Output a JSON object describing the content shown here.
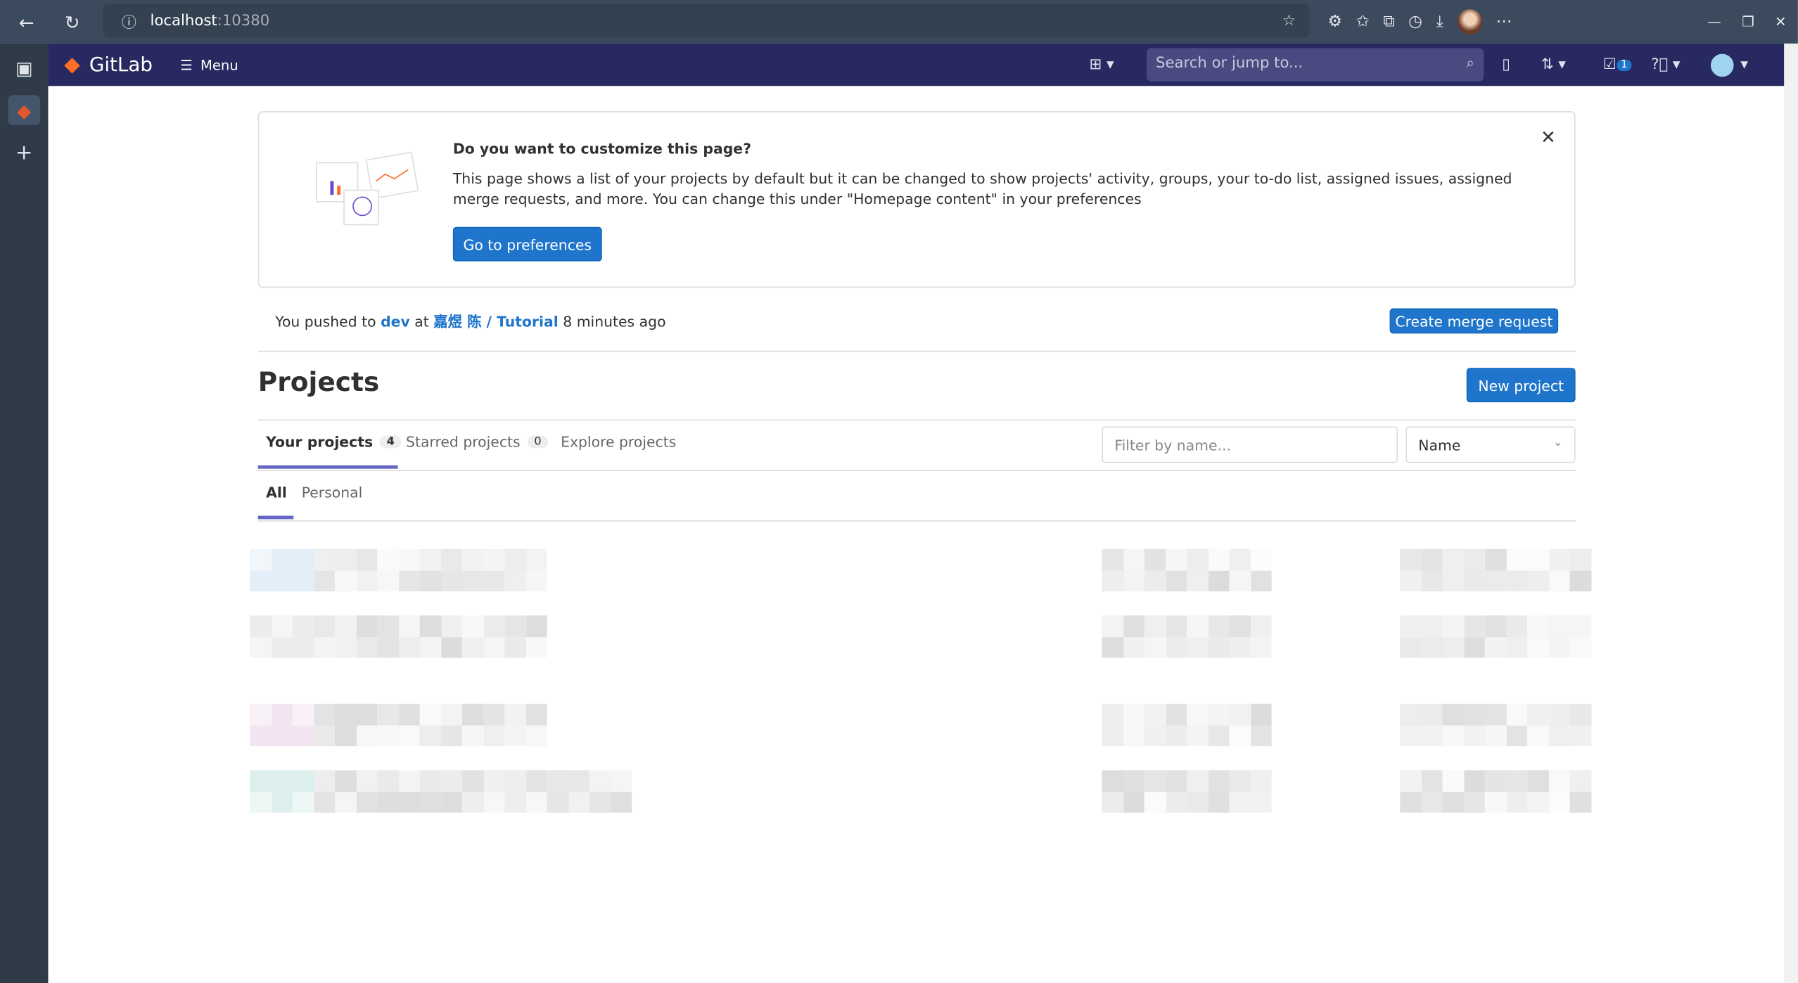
{
  "browser": {
    "url_host": "localhost",
    "url_port": ":10380"
  },
  "nav": {
    "brand": "GitLab",
    "menu": "Menu",
    "search_placeholder": "Search or jump to...",
    "todo_count": "1"
  },
  "banner": {
    "title": "Do you want to customize this page?",
    "body": "This page shows a list of your projects by default but it can be changed to show projects' activity, groups, your to-do list, assigned issues, assigned merge requests, and more. You can change this under \"Homepage content\" in your preferences",
    "button": "Go to preferences"
  },
  "push": {
    "prefix": "You pushed to",
    "branch": "dev",
    "at": "at",
    "project": "嘉煜 陈 / Tutorial",
    "time": "8 minutes ago",
    "button": "Create merge request"
  },
  "projects": {
    "title": "Projects",
    "new_button": "New project",
    "tabs": [
      {
        "label": "Your projects",
        "count": "4"
      },
      {
        "label": "Starred projects",
        "count": "0"
      },
      {
        "label": "Explore projects"
      }
    ],
    "filter_placeholder": "Filter by name...",
    "sort": "Name",
    "subtabs": [
      "All",
      "Personal"
    ]
  }
}
